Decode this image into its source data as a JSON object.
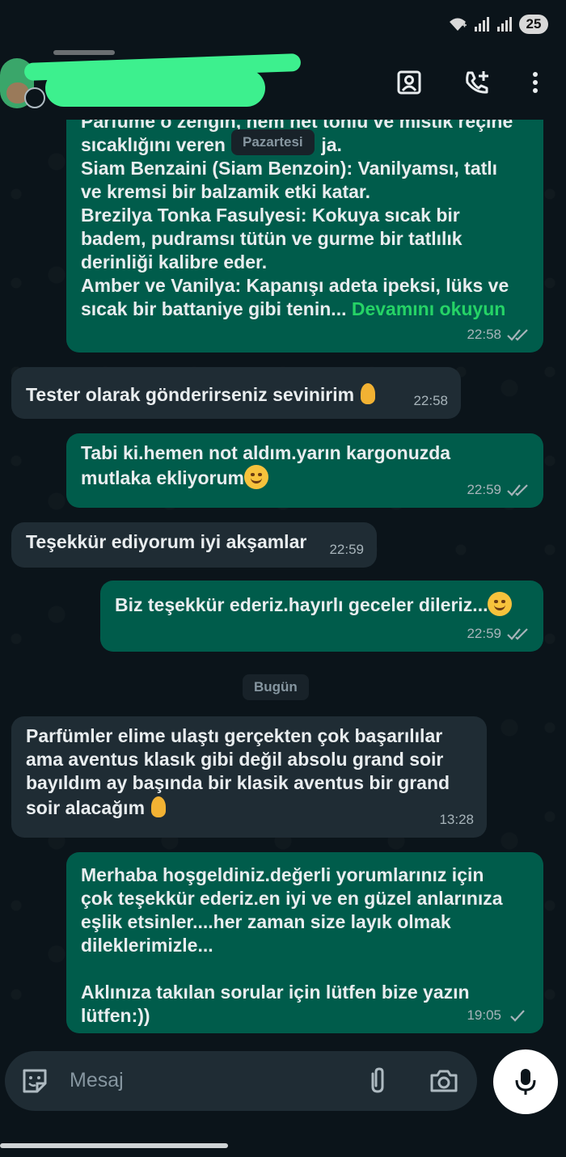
{
  "status_bar": {
    "battery": "25"
  },
  "header": {
    "contact_name": ""
  },
  "chat": {
    "messages": [
      {
        "direction": "out",
        "text": "Parfüme o zengin, hem net tonlu ve mistik reçine\nsıcaklığını veren ",
        "text2": "ja.\nSiam Benzaini (Siam Benzoin): Vanilyamsı, tatlı\nve kremsi bir balzamik etki katar.\nBrezilya Tonka Fasulyesi: Kokuya sıcak bir\nbadem, pudramsı tütün ve gurme bir tatlılık\nderinliği kalibre eder.\nAmber ve Vanilya: Kapanışı adeta ipeksi, lüks ve\nsıcak bir battaniye gibi tenin... ",
        "read_more": "Devamını okuyun",
        "time": "22:58"
      },
      {
        "direction": "in",
        "text": "Tester olarak gönderirseniz sevinirim ",
        "time": "22:58"
      },
      {
        "direction": "out",
        "text": "Tabi ki.hemen not aldım.yarın kargonuzda\nmutlaka ekliyorum",
        "time": "22:59"
      },
      {
        "direction": "in",
        "text": "Teşekkür ediyorum iyi akşamlar",
        "time": "22:59"
      },
      {
        "direction": "out",
        "text": "Biz teşekkür ederiz.hayırlı geceler dileriz...",
        "time": "22:59"
      },
      {
        "direction": "in",
        "text": "Parfümler elime ulaştı gerçekten çok başarılılar\nama aventus klasık gibi değil absolu grand soir\nbayıldım ay başında bir klasik aventus bir grand\nsoir alacağım ",
        "time": "13:28"
      },
      {
        "direction": "out",
        "text": "Merhaba hoşgeldiniz.değerli yorumlarınız için\nçok teşekkür ederiz.en iyi ve en güzel anlarınıza\neşlik etsinler....her zaman size layık olmak\ndileklerimizle...\n\nAklınıza takılan sorular için lütfen bize yazın\nlütfen:))",
        "time": "19:05"
      }
    ],
    "day_labels": {
      "floating": "Pazartesi",
      "today": "Bugün"
    }
  },
  "composer": {
    "placeholder": "Mesaj"
  },
  "icons": {
    "header": [
      "contact-card-icon",
      "add-call-icon",
      "more-vert-icon"
    ],
    "composer": [
      "sticker-icon",
      "attach-icon",
      "camera-icon"
    ],
    "mic": "mic-icon"
  },
  "colors": {
    "incoming": "#1f2c34",
    "outgoing": "#005c4b",
    "link": "#25d366",
    "background": "#0b141a"
  }
}
